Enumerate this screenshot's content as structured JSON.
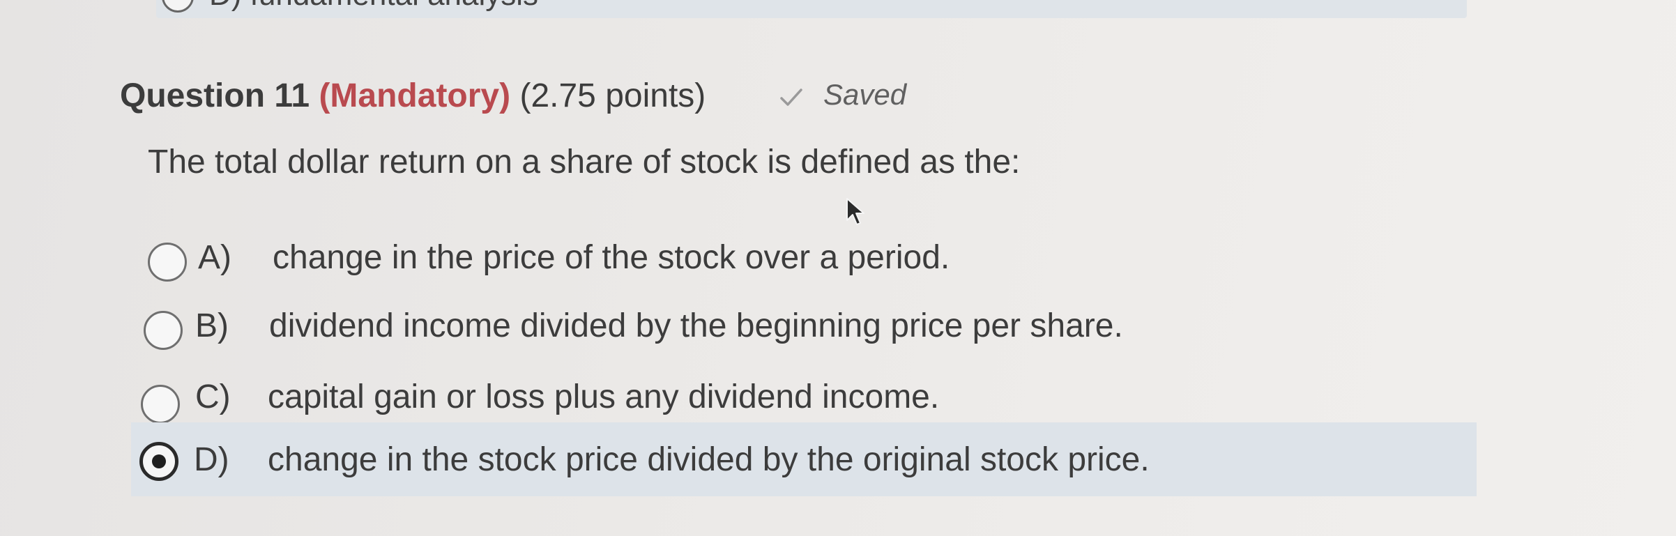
{
  "previous_option": {
    "label": "D)",
    "text": "fundamental analysis"
  },
  "question": {
    "title": "Question 11",
    "mandatory": "(Mandatory)",
    "points": "(2.75 points)",
    "status": "Saved",
    "text": "The total dollar return on a share of stock is defined as the:"
  },
  "options": [
    {
      "letter": "A)",
      "text": "change in the price of the stock over a period.",
      "selected": false
    },
    {
      "letter": "B)",
      "text": "dividend income divided by the beginning price per share.",
      "selected": false
    },
    {
      "letter": "C)",
      "text": "capital gain or loss plus any dividend income.",
      "selected": false
    },
    {
      "letter": "D)",
      "text": "change in the stock price divided by the original stock price.",
      "selected": true
    }
  ],
  "colors": {
    "mandatory": "#b94a4f",
    "selected_bg": "#dde3e9"
  }
}
